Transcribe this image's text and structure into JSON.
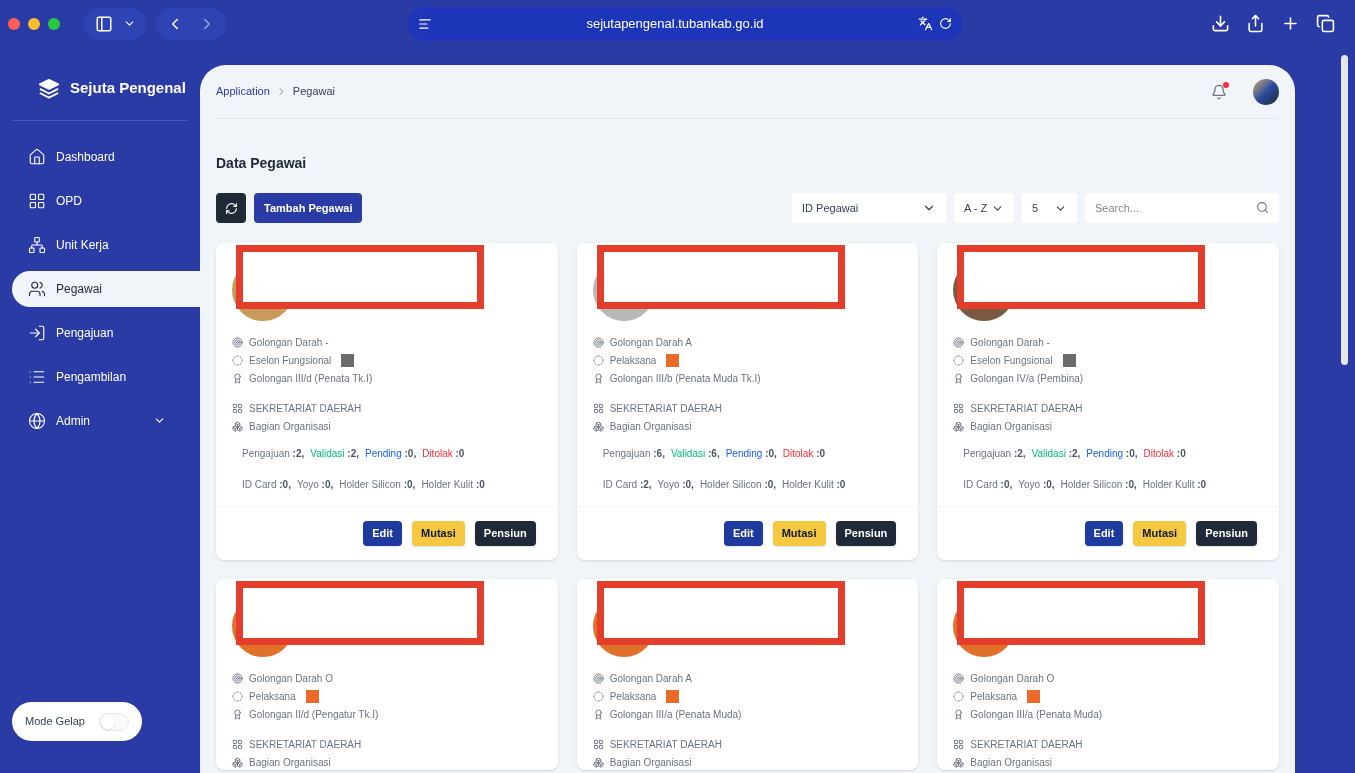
{
  "browser": {
    "url": "sejutapengenal.tubankab.go.id"
  },
  "sidebar": {
    "title": "Sejuta Pengenal",
    "items": [
      {
        "label": "Dashboard",
        "selected": false
      },
      {
        "label": "OPD",
        "selected": false
      },
      {
        "label": "Unit Kerja",
        "selected": false
      },
      {
        "label": "Pegawai",
        "selected": true
      },
      {
        "label": "Pengajuan",
        "selected": false
      },
      {
        "label": "Pengambilan",
        "selected": false
      },
      {
        "label": "Admin",
        "selected": false,
        "expanded": false
      }
    ],
    "dark_mode": {
      "label": "Mode Gelap",
      "on": false
    }
  },
  "breadcrumb": [
    "Application",
    "Pegawai"
  ],
  "page_title": "Data Pegawai",
  "toolbar": {
    "add_button": "Tambah Pegawai",
    "sort_field": "ID Pegawai",
    "sort_order": "A - Z",
    "page_size": "5",
    "search": {
      "placeholder": "Search..."
    }
  },
  "cards": [
    {
      "blood": "Golongan Darah -",
      "eselon": "Eselon Fungsional",
      "color": "#6b6b6b",
      "rank": "Golongan III/d (Penata Tk.I)",
      "opd": "SEKRETARIAT DAERAH",
      "unit": "Bagian Organisasi",
      "stats": [
        {
          "label": "Pengajuan",
          "value": ":2,",
          "kind": "total"
        },
        {
          "label": "Validasi",
          "value": ":2,",
          "kind": "valid"
        },
        {
          "label": "Pending",
          "value": ":0,",
          "kind": "pending"
        },
        {
          "label": "Ditolak",
          "value": ":0",
          "kind": "rejected"
        }
      ],
      "items": [
        {
          "label": "ID Card",
          "value": ":0,"
        },
        {
          "label": "Yoyo",
          "value": ":0,"
        },
        {
          "label": "Holder Silicon",
          "value": ":0,"
        },
        {
          "label": "Holder Kulit",
          "value": ":0"
        }
      ],
      "buttons": [
        "Edit",
        "Mutasi",
        "Pensiun"
      ]
    },
    {
      "blood": "Golongan Darah A",
      "eselon": "Pelaksana",
      "color": "#ea6a2a",
      "rank": "Golongan III/b (Penata Muda Tk.I)",
      "opd": "SEKRETARIAT DAERAH",
      "unit": "Bagian Organisasi",
      "stats": [
        {
          "label": "Pengajuan",
          "value": ":6,",
          "kind": "total"
        },
        {
          "label": "Validasi",
          "value": ":6,",
          "kind": "valid"
        },
        {
          "label": "Pending",
          "value": ":0,",
          "kind": "pending"
        },
        {
          "label": "Ditolak",
          "value": ":0",
          "kind": "rejected"
        }
      ],
      "items": [
        {
          "label": "ID Card",
          "value": ":2,"
        },
        {
          "label": "Yoyo",
          "value": ":0,"
        },
        {
          "label": "Holder Silicon",
          "value": ":0,"
        },
        {
          "label": "Holder Kulit",
          "value": ":0"
        }
      ],
      "buttons": [
        "Edit",
        "Mutasi",
        "Pensiun"
      ]
    },
    {
      "blood": "Golongan Darah -",
      "eselon": "Eselon Fungsional",
      "color": "#6b6b6b",
      "rank": "Golongan IV/a (Pembina)",
      "opd": "SEKRETARIAT DAERAH",
      "unit": "Bagian Organisasi",
      "stats": [
        {
          "label": "Pengajuan",
          "value": ":2,",
          "kind": "total"
        },
        {
          "label": "Validasi",
          "value": ":2,",
          "kind": "valid"
        },
        {
          "label": "Pending",
          "value": ":0,",
          "kind": "pending"
        },
        {
          "label": "Ditolak",
          "value": ":0",
          "kind": "rejected"
        }
      ],
      "items": [
        {
          "label": "ID Card",
          "value": ":0,"
        },
        {
          "label": "Yoyo",
          "value": ":0,"
        },
        {
          "label": "Holder Silicon",
          "value": ":0,"
        },
        {
          "label": "Holder Kulit",
          "value": ":0"
        }
      ],
      "buttons": [
        "Edit",
        "Mutasi",
        "Pensiun"
      ]
    },
    {
      "blood": "Golongan Darah O",
      "eselon": "Pelaksana",
      "color": "#ea6a2a",
      "rank": "Golongan II/d (Pengatur Tk.I)",
      "opd": "SEKRETARIAT DAERAH",
      "unit": "Bagian Organisasi"
    },
    {
      "blood": "Golongan Darah A",
      "eselon": "Pelaksana",
      "color": "#ea6a2a",
      "rank": "Golongan III/a (Penata Muda)",
      "opd": "SEKRETARIAT DAERAH",
      "unit": "Bagian Organisasi"
    },
    {
      "blood": "Golongan Darah O",
      "eselon": "Pelaksana",
      "color": "#ea6a2a",
      "rank": "Golongan III/a (Penata Muda)",
      "opd": "SEKRETARIAT DAERAH",
      "unit": "Bagian Organisasi"
    }
  ]
}
